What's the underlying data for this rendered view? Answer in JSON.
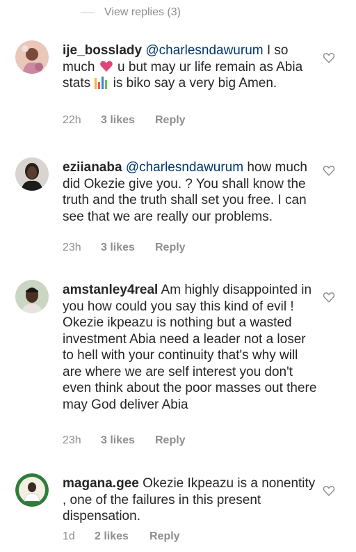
{
  "view_replies": "View replies (3)",
  "comments": [
    {
      "username": "ije_bosslady",
      "mention": "@charlesndawurum",
      "text_parts": [
        " I so much ",
        " u but may ur life remain as Abia stats ",
        " is biko say a very big Amen."
      ],
      "time": "22h",
      "likes": "3 likes",
      "reply": "Reply"
    },
    {
      "username": "eziianaba",
      "mention": "@charlesndawurum",
      "text": " how much did Okezie give you. ? You shall know the truth and the truth shall set you free. I can see that we are really our problems.",
      "time": "23h",
      "likes": "3 likes",
      "reply": "Reply"
    },
    {
      "username": "amstanley4real",
      "text": " Am highly disappointed in you how could you say this kind of evil ! Okezie ikpeazu is nothing but a wasted investment Abia need a leader not a loser to hell with your continuity that's why will are where we are self interest you don't even think about the poor masses out there may God deliver Abia",
      "time": "23h",
      "likes": "3 likes",
      "reply": "Reply"
    },
    {
      "username": "magana.gee",
      "text": " Okezie Ikpeazu is a nonentity , one of the failures in this present dispensation.",
      "time": "1d",
      "likes": "2 likes",
      "reply": "Reply"
    }
  ],
  "icons": {
    "heart": "heart-icon",
    "bars": "bar-chart-icon",
    "like": "heart-outline-icon"
  },
  "colors": {
    "text": "#262626",
    "muted": "#8e8e8e",
    "mention": "#00376b",
    "heart": "#e0457b"
  }
}
